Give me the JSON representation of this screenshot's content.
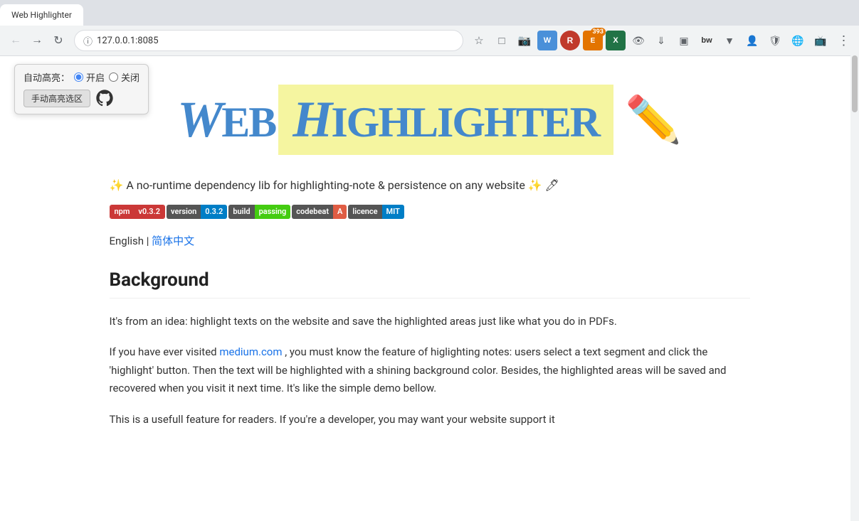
{
  "browser": {
    "address": "127.0.0.1:8085",
    "tab_title": "Web Highlighter"
  },
  "extension_overlay": {
    "auto_highlight_label": "自动高亮：",
    "on_label": "开启",
    "off_label": "关闭",
    "manual_button": "手动高亮选区"
  },
  "header": {
    "web_text": "Web",
    "highlighter_text": "Highlighter"
  },
  "page": {
    "description": "✨ A no-runtime dependency lib for highlighting-note & persistence on any website ✨ 🖊",
    "badges": [
      {
        "left": "npm",
        "right": "v0.3.2",
        "type": "npm"
      },
      {
        "left": "version",
        "right": "0.3.2",
        "type": "version"
      },
      {
        "left": "build",
        "right": "passing",
        "type": "build"
      },
      {
        "left": "codebeat",
        "right": "A",
        "type": "codebeat"
      },
      {
        "left": "licence",
        "right": "MIT",
        "type": "licence"
      }
    ],
    "lang_english": "English",
    "lang_separator": " | ",
    "lang_chinese": "简体中文",
    "section_background": "Background",
    "para1": "It's from an idea: highlight texts on the website and save the highlighted areas just like what you do in PDFs.",
    "para2_prefix": "If you have ever visited ",
    "para2_link": "medium.com",
    "para2_suffix": ", you must know the feature of higlighting notes: users select a text segment and click the 'highlight' button. Then the text will be highlighted with a shining background color. Besides, the highlighted areas will be saved and recovered when you visit it next time. It's like the simple demo bellow.",
    "para3": "This is a usefull feature for readers. If you're a developer, you may want your website support it"
  }
}
